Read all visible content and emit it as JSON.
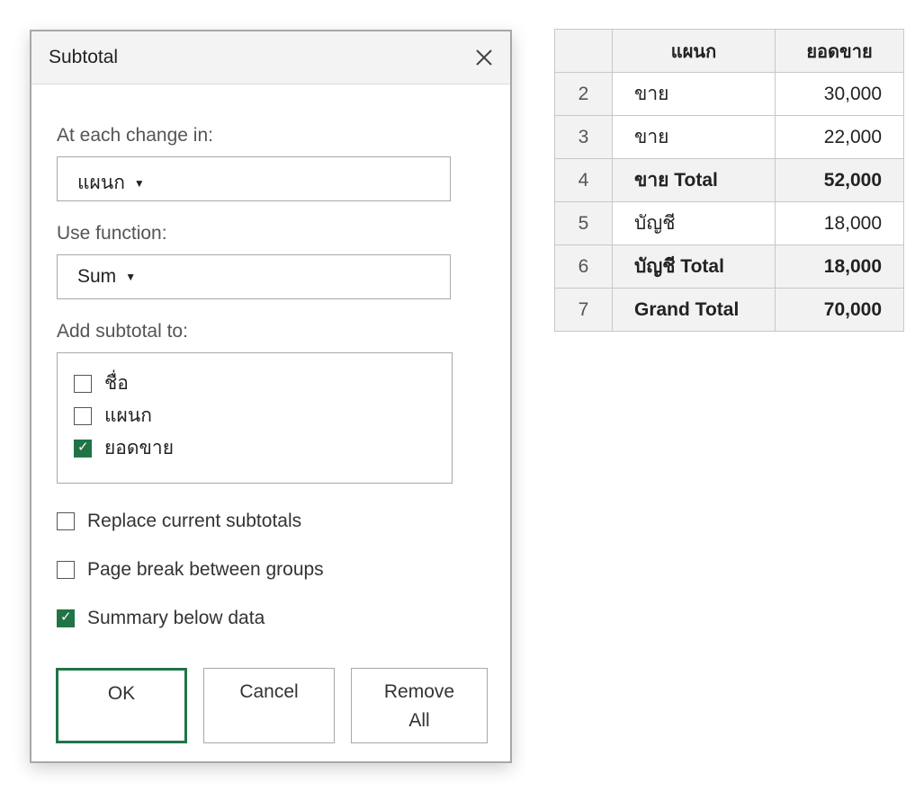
{
  "dialog": {
    "title": "Subtotal",
    "at_each_change_label": "At each change in:",
    "at_each_change_value": "แผนก",
    "use_function_label": "Use function:",
    "use_function_value": "Sum",
    "add_subtotal_label": "Add subtotal to:",
    "add_subtotal_items": [
      {
        "label": "ชื่อ",
        "checked": false
      },
      {
        "label": "แผนก",
        "checked": false
      },
      {
        "label": "ยอดขาย",
        "checked": true
      }
    ],
    "options": [
      {
        "label": "Replace current subtotals",
        "checked": false
      },
      {
        "label": "Page break between groups",
        "checked": false
      },
      {
        "label": "Summary below data",
        "checked": true
      }
    ],
    "buttons": {
      "ok": "OK",
      "cancel": "Cancel",
      "remove_all_line1": "Remove",
      "remove_all_line2": "All"
    },
    "dropdown_arrow": "▼"
  },
  "sheet": {
    "headers": [
      "",
      "แผนก",
      "ยอดขาย"
    ],
    "rows": [
      {
        "row": "2",
        "dept": "ขาย",
        "sales": "30,000",
        "bold": false
      },
      {
        "row": "3",
        "dept": "ขาย",
        "sales": "22,000",
        "bold": false
      },
      {
        "row": "4",
        "dept": "ขาย Total",
        "sales": "52,000",
        "bold": true
      },
      {
        "row": "5",
        "dept": "บัญชี",
        "sales": "18,000",
        "bold": false
      },
      {
        "row": "6",
        "dept": "บัญชี Total",
        "sales": "18,000",
        "bold": true
      },
      {
        "row": "7",
        "dept": "Grand Total",
        "sales": "70,000",
        "bold": true
      }
    ]
  },
  "colors": {
    "accent": "#217346",
    "border": "#a8a8a8",
    "header_bg": "#f2f2f2"
  }
}
